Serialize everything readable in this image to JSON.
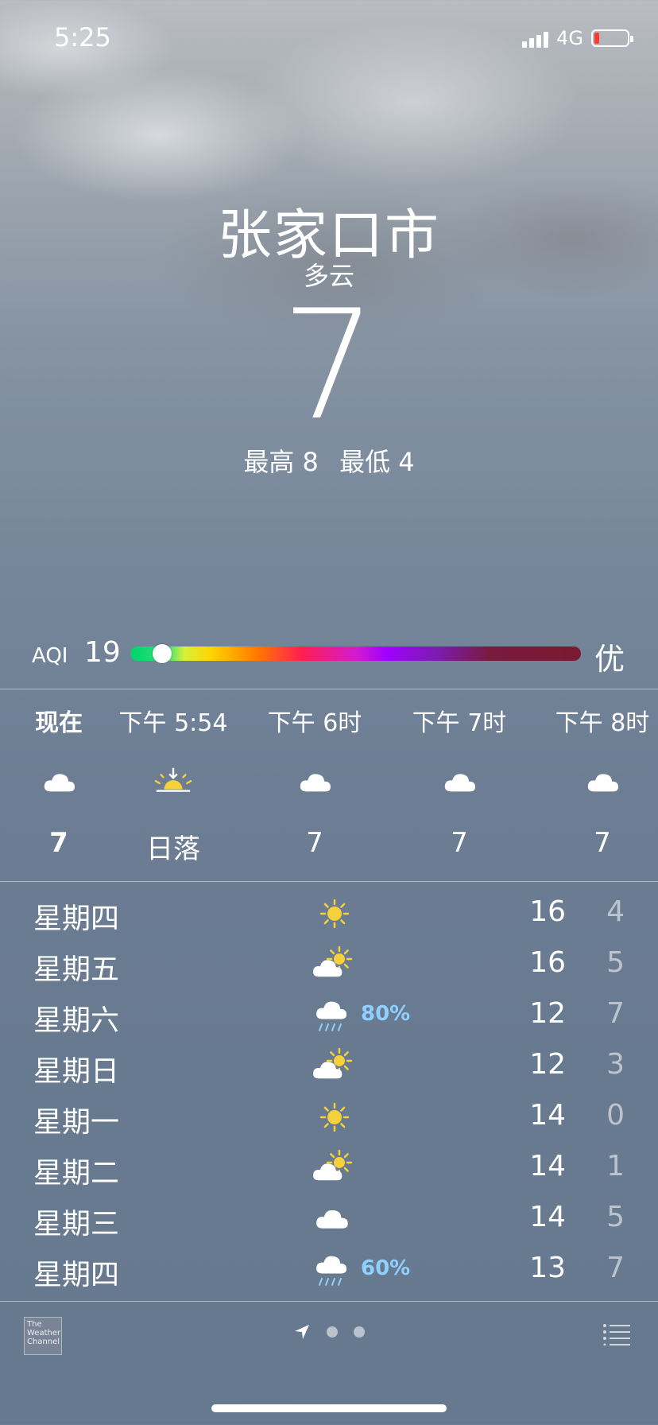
{
  "status_bar": {
    "time": "5:25",
    "network": "4G"
  },
  "header": {
    "city": "张家口市",
    "condition": "多云",
    "temperature": "7",
    "high": "最高 8",
    "low": "最低 4"
  },
  "aqi": {
    "label": "AQI",
    "value": "19",
    "level": "优",
    "position_fraction": 0.07
  },
  "hourly": [
    {
      "time": "现在",
      "icon": "cloud-icon",
      "temp": "7"
    },
    {
      "time": "下午 5:54",
      "icon": "sunset-icon",
      "temp": "日落"
    },
    {
      "time": "下午 6时",
      "icon": "cloud-icon",
      "temp": "7"
    },
    {
      "time": "下午 7时",
      "icon": "cloud-icon",
      "temp": "7"
    },
    {
      "time": "下午 8时",
      "icon": "cloud-icon",
      "temp": "7"
    }
  ],
  "daily": [
    {
      "day": "星期四",
      "icon": "sun-icon",
      "precip": "",
      "high": "16",
      "low": "4"
    },
    {
      "day": "星期五",
      "icon": "partly-cloudy-icon",
      "precip": "",
      "high": "16",
      "low": "5"
    },
    {
      "day": "星期六",
      "icon": "rain-icon",
      "precip": "80%",
      "high": "12",
      "low": "7"
    },
    {
      "day": "星期日",
      "icon": "partly-cloudy-icon",
      "precip": "",
      "high": "12",
      "low": "3"
    },
    {
      "day": "星期一",
      "icon": "sun-icon",
      "precip": "",
      "high": "14",
      "low": "0"
    },
    {
      "day": "星期二",
      "icon": "partly-cloudy-icon",
      "precip": "",
      "high": "14",
      "low": "1"
    },
    {
      "day": "星期三",
      "icon": "cloud-icon",
      "precip": "",
      "high": "14",
      "low": "5"
    },
    {
      "day": "星期四",
      "icon": "rain-icon",
      "precip": "60%",
      "high": "13",
      "low": "7"
    }
  ],
  "footer": {
    "provider": "The Weather Channel"
  },
  "colors": {
    "precip": "#8fd0ff",
    "sun": "#f7d13a",
    "battery_low": "#ff3b30"
  }
}
